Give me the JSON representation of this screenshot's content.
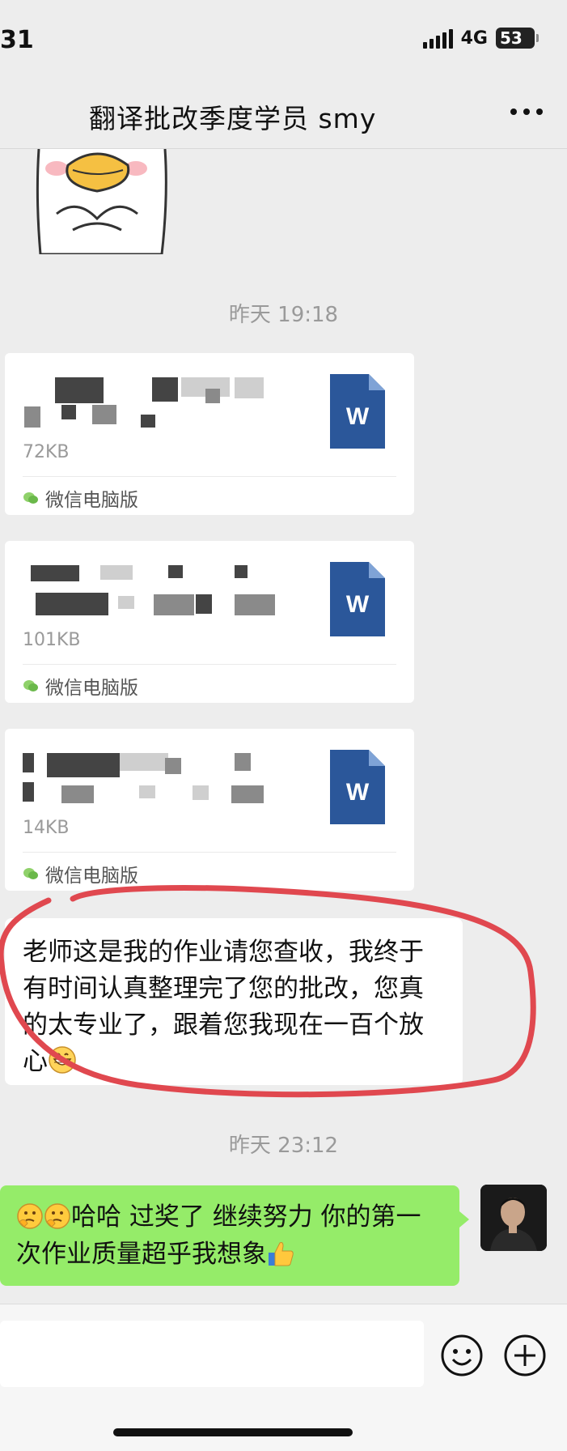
{
  "status_bar": {
    "time": "31",
    "network": "4G",
    "battery": "53"
  },
  "header": {
    "title": "翻译批改季度学员 smy"
  },
  "messages": {
    "timestamp_1": "昨天 19:18",
    "files": [
      {
        "size": "72KB",
        "source": "微信电脑版",
        "icon_letter": "W"
      },
      {
        "size": "101KB",
        "source": "微信电脑版",
        "icon_letter": "W"
      },
      {
        "size": "14KB",
        "source": "微信电脑版",
        "icon_letter": "W"
      }
    ],
    "incoming_text": "老师这是我的作业请您查收，我终于有时间认真整理完了您的批改，您真的太专业了，跟着您我现在一百个放心",
    "timestamp_2": "昨天 23:12",
    "outgoing_text_part1": "哈哈 过奖了 继续努力 你的第一次作业质量超乎我想象"
  },
  "colors": {
    "outgoing_bubble": "#95ec69",
    "annotation": "#e0484f",
    "word_blue": "#2b579a"
  }
}
